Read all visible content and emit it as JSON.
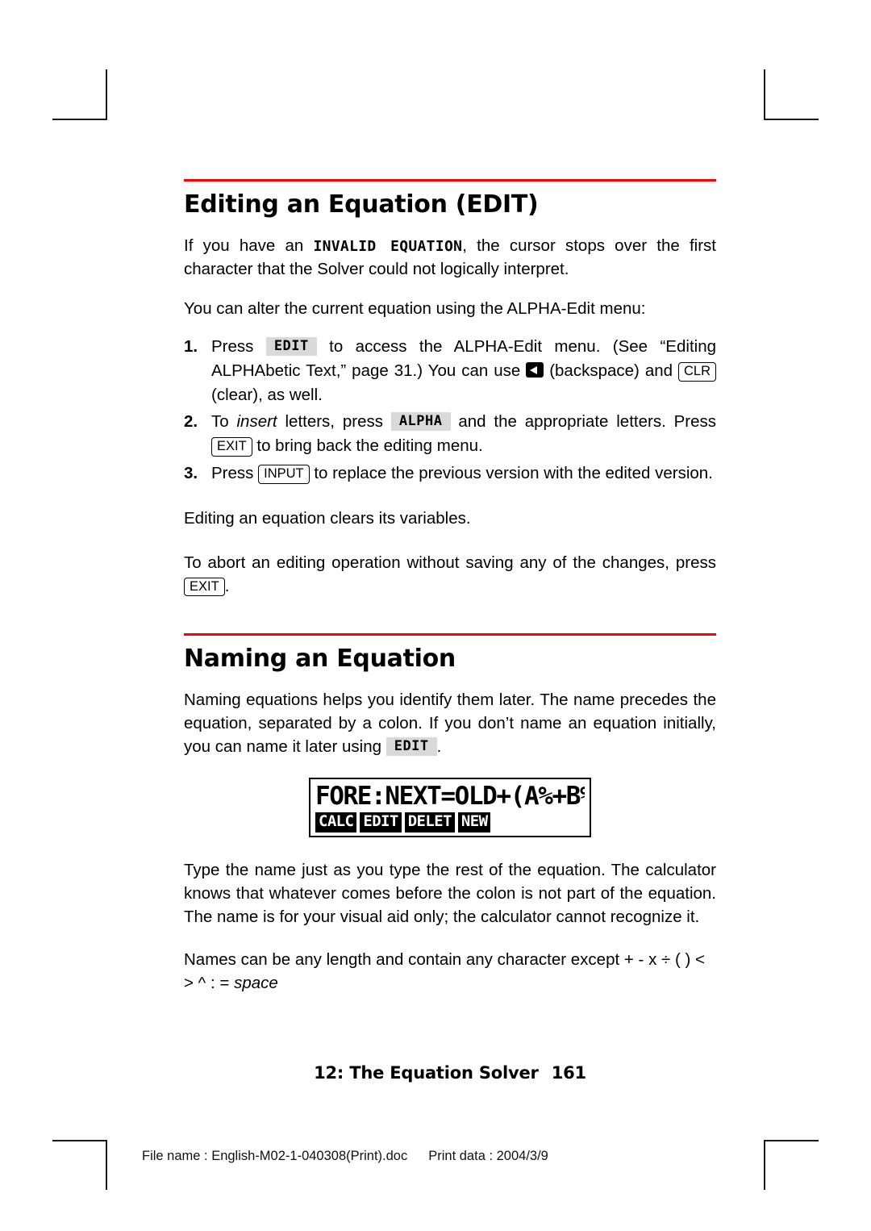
{
  "sections": [
    {
      "title": "Editing an Equation (EDIT)",
      "intro_a": "If you have an ",
      "intro_code": "INVALID EQUATION",
      "intro_b": ", the cursor stops over the first character that the Solver could not logically interpret.",
      "intro2": "You can alter the current equation using the ALPHA-Edit menu:",
      "steps": [
        {
          "num": "1.",
          "a": "Press",
          "key1": "EDIT",
          "b": "to access the ALPHA-Edit menu. (See “Editing ALPHAbetic Text,” page 31.) You can use",
          "backspace_icon": "backspace-arrow-icon",
          "c": "(backspace) and",
          "key2": "CLR",
          "d": "(clear), as well."
        },
        {
          "num": "2.",
          "a": "To",
          "em": "insert",
          "b": "letters, press",
          "key1": "ALPHA",
          "c": "and the appropriate letters. Press",
          "key2": "EXIT",
          "d": "to bring back the editing menu."
        },
        {
          "num": "3.",
          "a": "Press",
          "key1": "INPUT",
          "b": "to replace the previous version with the edited version."
        }
      ],
      "note1": "Editing an equation clears its variables.",
      "note2_a": "To abort an editing operation without saving any of the changes, press",
      "note2_key": "EXIT",
      "note2_b": "."
    },
    {
      "title": "Naming an Equation",
      "para_a": "Naming equations helps you identify them later. The name precedes the equation, separated by a colon. If you don’t name an equation initially, you can name it later using",
      "para_key": "EDIT",
      "para_b": ".",
      "lcd": {
        "display_line": "FORE:NEXT=OLD+(A%+B%+…",
        "menu": [
          "CALC",
          "EDIT",
          "DELET",
          "NEW"
        ]
      },
      "para2": "Type the name just as you type the rest of the equation. The calculator knows that whatever comes before the colon is not part of the equation. The name is for your visual aid only; the calculator cannot recognize it.",
      "para3_a": "Names can be any length and contain any character except",
      "para3_chars": "+  -  x ÷ ( )  <  >  ^  :  =",
      "para3_space": "space"
    }
  ],
  "page_footer": {
    "chapter": "12: The Equation Solver",
    "page_number": "161"
  },
  "doc_footer": {
    "file_label": "File name : English-M02-1-040308(Print).doc",
    "print_label": "Print data : 2004/3/9"
  },
  "colors": {
    "rule": "#FF0000",
    "softkey_bg": "#D9D9D9"
  }
}
